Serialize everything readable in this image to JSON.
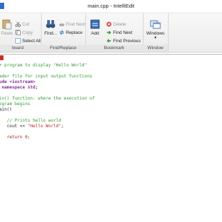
{
  "window": {
    "title": "main.cpp - IntelliEdit"
  },
  "ribbon": {
    "groups": [
      {
        "label": "board"
      },
      {
        "label": "Find/Replace"
      },
      {
        "label": "Bookmark"
      },
      {
        "label": "Window"
      }
    ],
    "clipboard": {
      "paste": "Paste",
      "cut": "Cut",
      "copy": "Copy",
      "select_all": "Select All"
    },
    "find": {
      "find": "Find...",
      "find_next": "Find Next",
      "replace": "Replace"
    },
    "bookmark": {
      "add": "Add",
      "delete": "Delete",
      "find_next": "Find Next",
      "find_previous": "Find Previous"
    },
    "window": {
      "windows": "Windows"
    }
  },
  "code_lines": [
    {
      "cls": "c-comment",
      "text": "++ program to display \"Hello World\""
    },
    {
      "cls": "c-plain",
      "text": ""
    },
    {
      "cls": "c-comment",
      "text": "eader file for input output functions"
    },
    {
      "cls": "c-key",
      "text": "lude <iostream>"
    },
    {
      "cls": "c-key",
      "text": "g namespace std;"
    },
    {
      "cls": "c-plain",
      "text": ""
    },
    {
      "cls": "c-comment",
      "text": "ain() function: where the execution of"
    },
    {
      "cls": "c-comment",
      "text": "rogram begins"
    },
    {
      "cls": "c-plain",
      "text": "main()"
    },
    {
      "cls": "c-plain",
      "text": ""
    },
    {
      "cls": "c-comment",
      "text": "    // Prints hello world"
    },
    {
      "cls": "c-plain",
      "text": "    cout << \"Hello World\";"
    },
    {
      "cls": "c-plain",
      "text": ""
    },
    {
      "cls": "c-kw2",
      "text": "    return 0;"
    }
  ],
  "colors": {
    "accent": "#2a6fc9",
    "comment": "#2f9b2f",
    "keyword": "#8a2a9a",
    "string": "#c81e1e"
  },
  "icons": [
    "paste-icon",
    "cut-icon",
    "copy-icon",
    "select-all-icon",
    "binoculars-icon",
    "find-next-icon",
    "replace-icon",
    "bookmark-add-icon",
    "delete-icon",
    "arrow-next-icon",
    "arrow-prev-icon",
    "windows-icon"
  ]
}
